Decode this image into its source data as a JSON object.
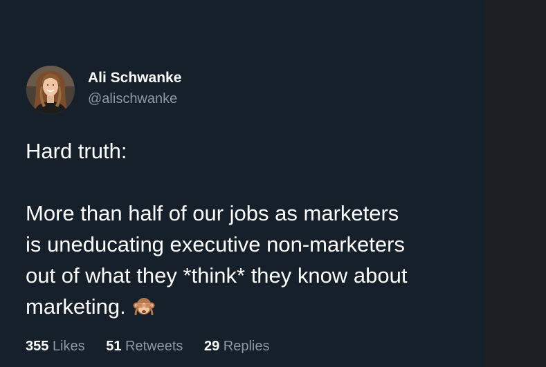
{
  "tweet": {
    "author": {
      "name": "Ali Schwanke",
      "handle": "@alischwanke",
      "avatar_icon": "profile-photo-avatar"
    },
    "text": {
      "line1": "Hard truth:",
      "line2": "More than half of our jobs as marketers",
      "line3": "is uneducating executive non-marketers",
      "line4": "out of what they *think* they know about",
      "line5": "marketing.",
      "emoji_icon": "see-no-evil-monkey-emoji"
    },
    "stats": {
      "likes_count": "355",
      "likes_label": "Likes",
      "retweets_count": "51",
      "retweets_label": "Retweets",
      "replies_count": "29",
      "replies_label": "Replies"
    }
  },
  "colors": {
    "background": "#15202b",
    "side_panel": "#1c1f23",
    "primary_text": "#ffffff",
    "secondary_text": "#8b98a5"
  }
}
